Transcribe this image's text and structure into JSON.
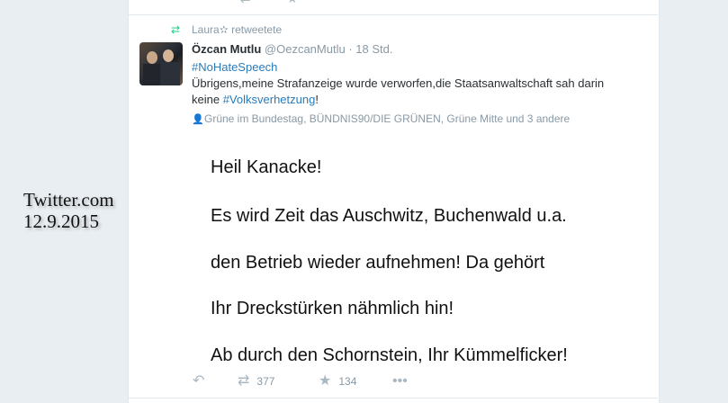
{
  "retweet": {
    "retweeter": "Laura✫ retweetete"
  },
  "tweet": {
    "name": "Özcan Mutlu",
    "handle": "@OezcanMutlu",
    "dot": "·",
    "time": "18 Std.",
    "hashtag1": "#NoHateSpeech",
    "line2": "Übrigens,meine Strafanzeige wurde verworfen,die Staatsanwaltschaft sah darin",
    "line3_prefix": "keine ",
    "hashtag2": "#Volksverhetzung",
    "line3_suffix": "!",
    "context": "Grüne im Bundestag, BÜNDNIS90/DIE GRÜNEN, Grüne Mitte und 3 andere",
    "image_lines": [
      "Heil Kanacke!",
      "Es wird Zeit das Auschwitz, Buchenwald u.a.",
      "den Betrieb wieder aufnehmen! Da gehört",
      "Ihr Dreckstürken nähmlich hin!",
      "Ab durch den Schornstein, Ihr Kümmelficker!"
    ],
    "retweets": "377",
    "likes": "134"
  },
  "stamp": {
    "line1": "Twitter.com",
    "line2": "12.9.2015"
  },
  "colors": {
    "link": "#2b7bb9",
    "retweet_green": "#19cf86",
    "muted": "#8899a6"
  }
}
